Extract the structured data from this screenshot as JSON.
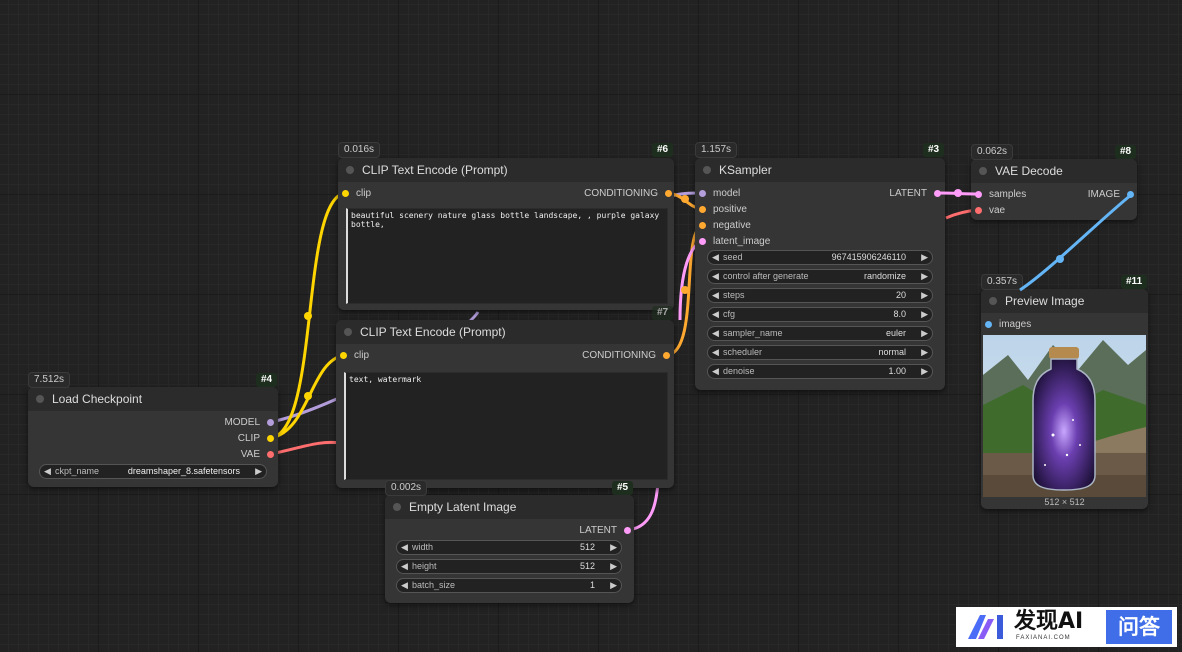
{
  "colors": {
    "model": "#b39ddb",
    "clip": "#ffd500",
    "vae": "#ff6e6e",
    "conditioning": "#ffa931",
    "latent": "#ff9cf9",
    "image": "#64b5f6"
  },
  "nodes": {
    "load_checkpoint": {
      "time": "7.512s",
      "id": "#4",
      "title": "Load Checkpoint",
      "outputs": [
        "MODEL",
        "CLIP",
        "VAE"
      ],
      "widget": {
        "label": "ckpt_name",
        "value": "dreamshaper_8.safetensors"
      }
    },
    "clip_pos": {
      "time": "0.016s",
      "id": "#6",
      "title": "CLIP Text Encode (Prompt)",
      "input": "clip",
      "output": "CONDITIONING",
      "text": "beautiful scenery nature glass bottle landscape, , purple galaxy bottle,"
    },
    "clip_neg": {
      "id": "#7",
      "title": "CLIP Text Encode (Prompt)",
      "input": "clip",
      "output": "CONDITIONING",
      "text": "text, watermark"
    },
    "ksampler": {
      "time": "1.157s",
      "id": "#3",
      "title": "KSampler",
      "inputs": [
        "model",
        "positive",
        "negative",
        "latent_image"
      ],
      "output": "LATENT",
      "widgets": [
        {
          "label": "seed",
          "value": "967415906246110"
        },
        {
          "label": "control after generate",
          "value": "randomize"
        },
        {
          "label": "steps",
          "value": "20"
        },
        {
          "label": "cfg",
          "value": "8.0"
        },
        {
          "label": "sampler_name",
          "value": "euler"
        },
        {
          "label": "scheduler",
          "value": "normal"
        },
        {
          "label": "denoise",
          "value": "1.00"
        }
      ]
    },
    "vae_decode": {
      "time": "0.062s",
      "id": "#8",
      "title": "VAE Decode",
      "inputs": [
        "samples",
        "vae"
      ],
      "output": "IMAGE"
    },
    "preview": {
      "time": "0.357s",
      "id": "#11",
      "title": "Preview Image",
      "input": "images",
      "size": "512 × 512"
    },
    "empty_latent": {
      "time": "0.002s",
      "id": "#5",
      "title": "Empty Latent Image",
      "output": "LATENT",
      "widgets": [
        {
          "label": "width",
          "value": "512"
        },
        {
          "label": "height",
          "value": "512"
        },
        {
          "label": "batch_size",
          "value": "1"
        }
      ]
    }
  },
  "watermark": {
    "brand": "发现AI",
    "sub": "FAXIANAI.COM",
    "tag": "问答"
  }
}
